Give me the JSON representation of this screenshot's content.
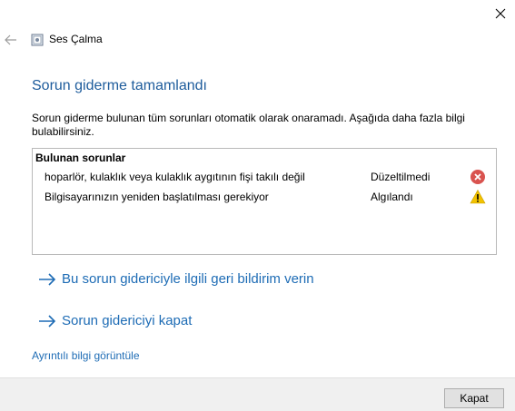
{
  "window": {
    "title": "Ses Çalma"
  },
  "main": {
    "heading": "Sorun giderme tamamlandı",
    "description": "Sorun giderme bulunan tüm sorunları otomatik olarak onaramadı. Aşağıda daha fazla bilgi bulabilirsiniz."
  },
  "issues": {
    "header": "Bulunan sorunlar",
    "rows": [
      {
        "text": "hoparlör, kulaklık veya kulaklık aygıtının fişi takılı değil",
        "status": "Düzeltilmedi",
        "icon": "error-icon"
      },
      {
        "text": "Bilgisayarınızın yeniden başlatılması gerekiyor",
        "status": "Algılandı",
        "icon": "warning-icon"
      }
    ]
  },
  "links": {
    "feedback": "Bu sorun gidericiyle ilgili geri bildirim verin",
    "close_troubleshooter": "Sorun gidericiyi kapat",
    "details": "Ayrıntılı bilgi görüntüle"
  },
  "footer": {
    "close_button": "Kapat"
  },
  "colors": {
    "heading": "#1e5c9c",
    "link": "#1e6cb5",
    "error": "#d9534f",
    "warning": "#f2c200"
  }
}
